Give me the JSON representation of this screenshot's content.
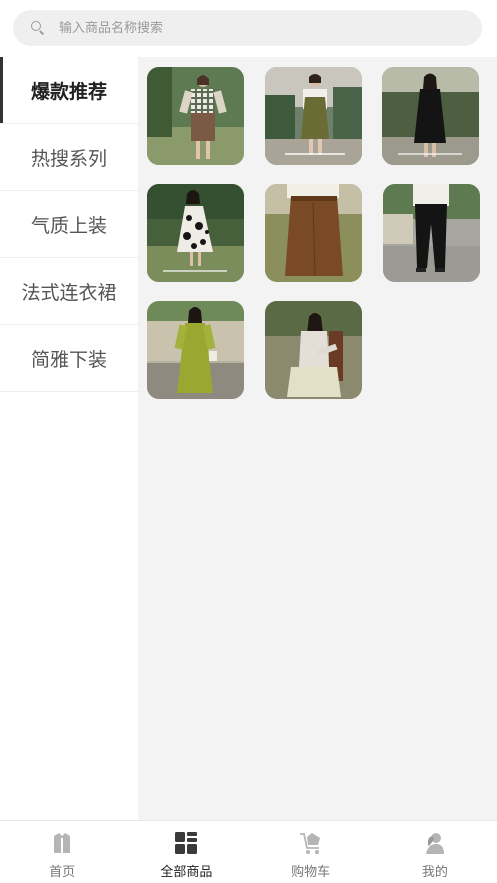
{
  "search": {
    "placeholder": "输入商品名称搜索",
    "value": ""
  },
  "sidebar": {
    "items": [
      {
        "label": "爆款推荐",
        "active": true
      },
      {
        "label": "热搜系列",
        "active": false
      },
      {
        "label": "气质上装",
        "active": false
      },
      {
        "label": "法式连衣裙",
        "active": false
      },
      {
        "label": "简雅下装",
        "active": false
      }
    ]
  },
  "products": [
    {
      "name": "plaid-top-brown-skirt"
    },
    {
      "name": "white-shirt-olive-dress"
    },
    {
      "name": "black-dress"
    },
    {
      "name": "floral-dress"
    },
    {
      "name": "brown-skirt"
    },
    {
      "name": "black-pants"
    },
    {
      "name": "green-dress"
    },
    {
      "name": "white-cardigan"
    }
  ],
  "tabbar": {
    "items": [
      {
        "label": "首页",
        "icon": "home-icon",
        "active": false
      },
      {
        "label": "全部商品",
        "icon": "grid-icon",
        "active": true
      },
      {
        "label": "购物车",
        "icon": "cart-icon",
        "active": false
      },
      {
        "label": "我的",
        "icon": "user-icon",
        "active": false
      }
    ]
  },
  "colors": {
    "accent": "#333333",
    "background": "#f3f3f3"
  }
}
